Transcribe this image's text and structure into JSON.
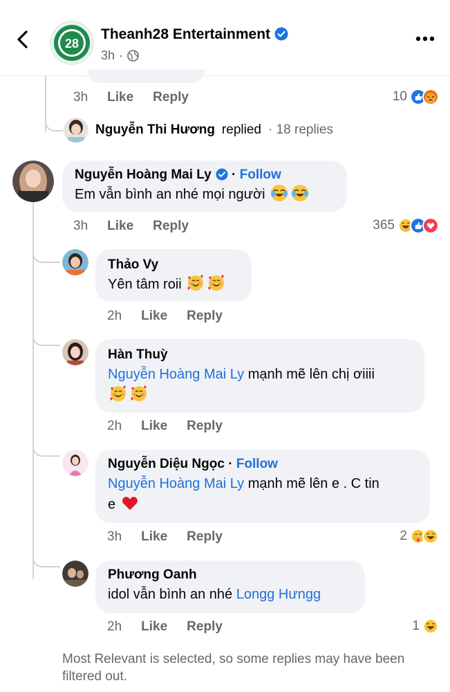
{
  "header": {
    "page_name": "Theanh28 Entertainment",
    "page_avatar_text": "28",
    "time": "3h",
    "time_separator": "·"
  },
  "top_comment": {
    "time": "3h",
    "like": "Like",
    "reply": "Reply",
    "reaction_count": "10",
    "replied_name": "Nguyễn Thi Hương",
    "replied_word": "replied",
    "replies": "· 18 replies"
  },
  "comments": [
    {
      "author": "Nguyễn Hoàng Mai Ly",
      "follow": "Follow",
      "text": "Em vẫn bình an nhé mọi người",
      "time": "3h",
      "like": "Like",
      "reply": "Reply",
      "reaction_count": "365"
    },
    {
      "author": "Thảo Vy",
      "text": "Yên tâm roii",
      "time": "2h",
      "like": "Like",
      "reply": "Reply"
    },
    {
      "author": "Hàn Thuỳ",
      "mention": "Nguyễn Hoàng Mai Ly",
      "text": "mạnh mẽ lên chị ơiiii",
      "time": "2h",
      "like": "Like",
      "reply": "Reply"
    },
    {
      "author": "Nguyễn Diệu Ngọc",
      "follow": "Follow",
      "mention": "Nguyễn Hoàng Mai Ly",
      "text_line1": "mạnh mẽ lên e . C tin",
      "text_line2": "e",
      "time": "3h",
      "like": "Like",
      "reply": "Reply",
      "reaction_count": "2"
    },
    {
      "author": "Phương Oanh",
      "text": "idol vẫn bình an nhé",
      "mention": "Longg Hưngg",
      "time": "2h",
      "like": "Like",
      "reply": "Reply",
      "reaction_count": "1"
    }
  ],
  "footer": {
    "note": "Most Relevant is selected, so some replies may have been filtered out."
  },
  "colors": {
    "link_blue": "#216fdb",
    "bubble_bg": "#f0f2f5",
    "muted_text": "#65676b",
    "page_green": "#1f8a4c"
  },
  "icons": [
    "back-arrow-icon",
    "verified-badge-icon",
    "globe-icon",
    "more-icon",
    "like-reaction-icon",
    "angry-reaction-icon",
    "haha-reaction-icon",
    "love-reaction-icon",
    "care-reaction-icon",
    "laughing-tears-emoji",
    "smiling-hearts-emoji",
    "red-heart-emoji"
  ]
}
